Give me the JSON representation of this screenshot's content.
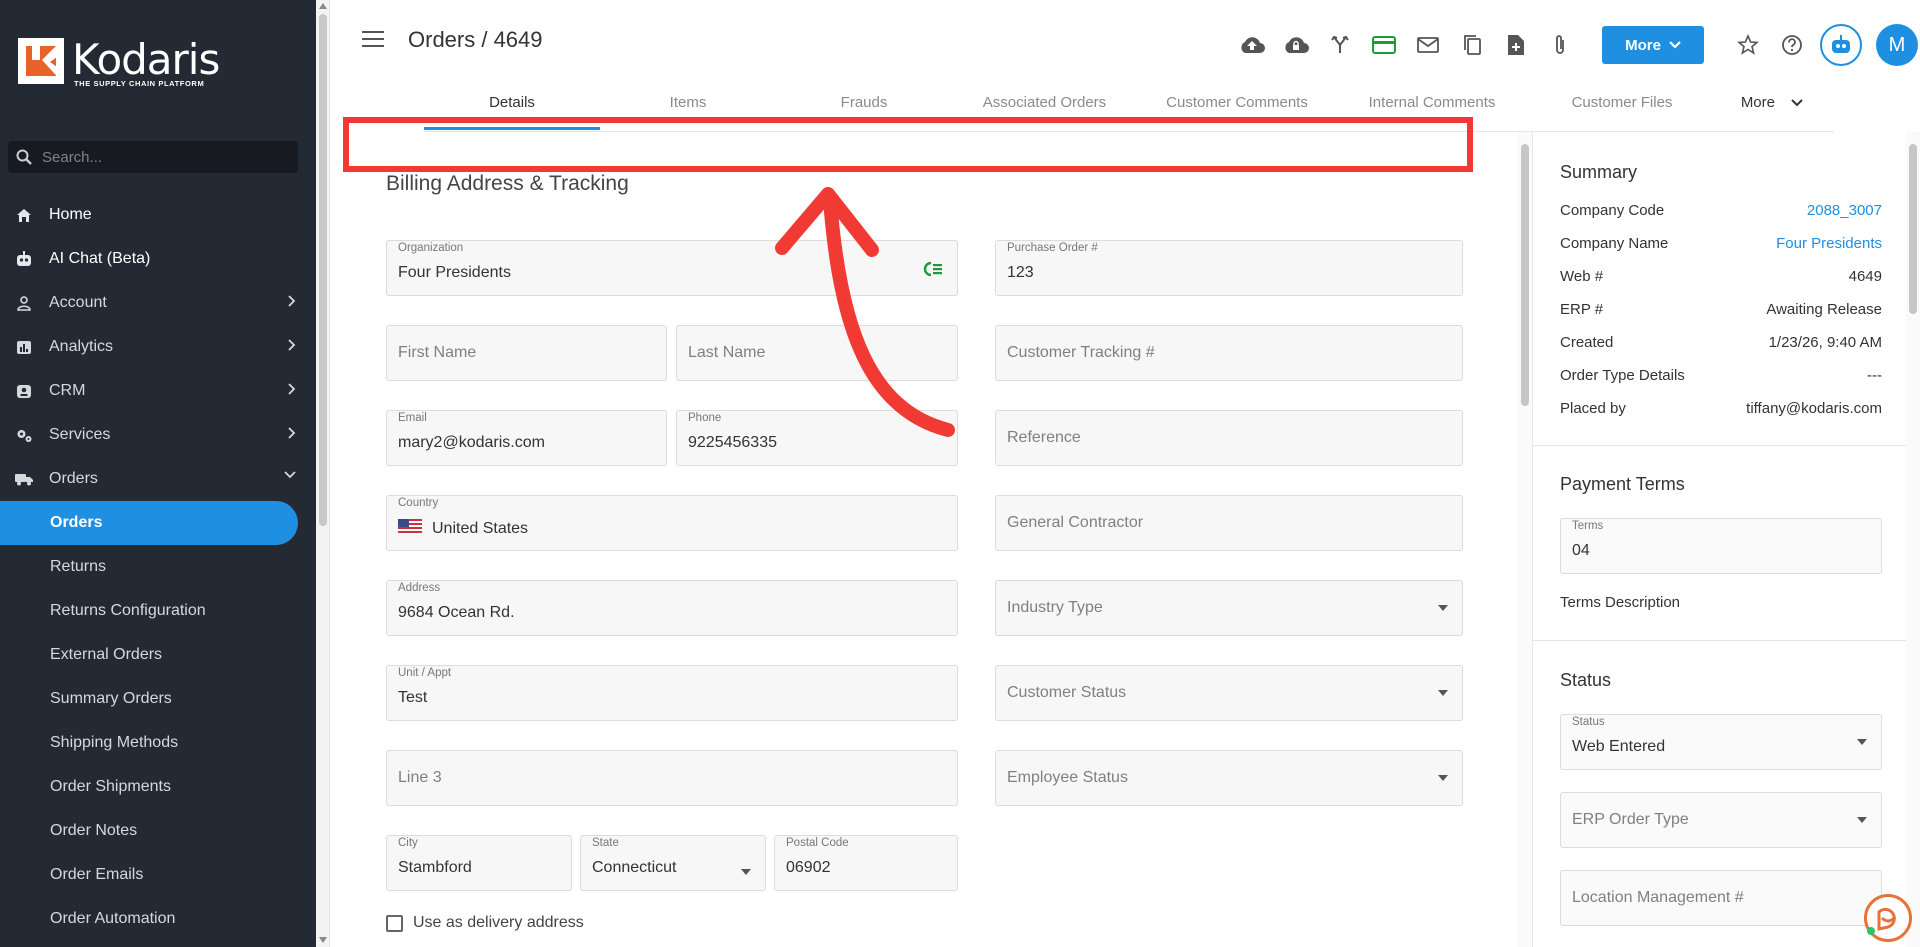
{
  "app": {
    "logo_name": "Kodaris",
    "logo_tagline": "THE SUPPLY CHAIN PLATFORM"
  },
  "sidebar": {
    "search_placeholder": "Search...",
    "items": [
      {
        "label": "Home",
        "icon": "home-icon"
      },
      {
        "label": "AI Chat (Beta)",
        "icon": "robot-icon"
      },
      {
        "label": "Account",
        "icon": "person-icon"
      },
      {
        "label": "Analytics",
        "icon": "analytics-icon"
      },
      {
        "label": "CRM",
        "icon": "crm-icon"
      },
      {
        "label": "Services",
        "icon": "services-icon"
      },
      {
        "label": "Orders",
        "icon": "truck-icon"
      }
    ],
    "sub_items": [
      "Orders",
      "Returns",
      "Returns Configuration",
      "External Orders",
      "Summary Orders",
      "Shipping Methods",
      "Order Shipments",
      "Order Notes",
      "Order Emails",
      "Order Automation"
    ]
  },
  "header": {
    "title": "Orders / 4649",
    "more_label": "More",
    "avatar_initial": "M",
    "accent": "#1e8fe1"
  },
  "tabs": [
    "Details",
    "Items",
    "Frauds",
    "Associated Orders",
    "Customer Comments",
    "Internal Comments",
    "Customer Files",
    "More"
  ],
  "billing": {
    "section_title": "Billing Address & Tracking",
    "organization_label": "Organization",
    "organization": "Four Presidents",
    "first_name_placeholder": "First Name",
    "last_name_placeholder": "Last Name",
    "email_label": "Email",
    "email": "mary2@kodaris.com",
    "phone_label": "Phone",
    "phone": "9225456335",
    "country_label": "Country",
    "country": "United States",
    "address_label": "Address",
    "address": "9684 Ocean Rd.",
    "unit_label": "Unit / Appt",
    "unit": "Test",
    "line3_placeholder": "Line 3",
    "city_label": "City",
    "city": "Stambford",
    "state_label": "State",
    "state": "Connecticut",
    "postal_label": "Postal Code",
    "postal": "06902",
    "delivery_checkbox": "Use as delivery address"
  },
  "tracking": {
    "po_label": "Purchase Order #",
    "po": "123",
    "customer_tracking_placeholder": "Customer Tracking #",
    "reference_placeholder": "Reference",
    "general_contractor_placeholder": "General Contractor",
    "industry_type_placeholder": "Industry Type",
    "customer_status_placeholder": "Customer Status",
    "employee_status_placeholder": "Employee Status"
  },
  "summary": {
    "title": "Summary",
    "rows": [
      {
        "label": "Company Code",
        "value": "2088_3007",
        "link": true
      },
      {
        "label": "Company Name",
        "value": "Four Presidents",
        "link": true
      },
      {
        "label": "Web #",
        "value": "4649",
        "link": false
      },
      {
        "label": "ERP #",
        "value": "Awaiting Release",
        "link": false
      },
      {
        "label": "Created",
        "value": "1/23/26, 9:40 AM",
        "link": false
      },
      {
        "label": "Order Type Details",
        "value": "---",
        "link": false
      },
      {
        "label": "Placed by",
        "value": "tiffany@kodaris.com",
        "link": false
      }
    ]
  },
  "payment_terms": {
    "title": "Payment Terms",
    "terms_label": "Terms",
    "terms": "04",
    "description_label": "Terms Description"
  },
  "status": {
    "title": "Status",
    "status_label": "Status",
    "status": "Web Entered",
    "erp_order_type_placeholder": "ERP Order Type",
    "location_placeholder": "Location Management #"
  },
  "annotation": {
    "highlight_color": "#f03a33"
  }
}
